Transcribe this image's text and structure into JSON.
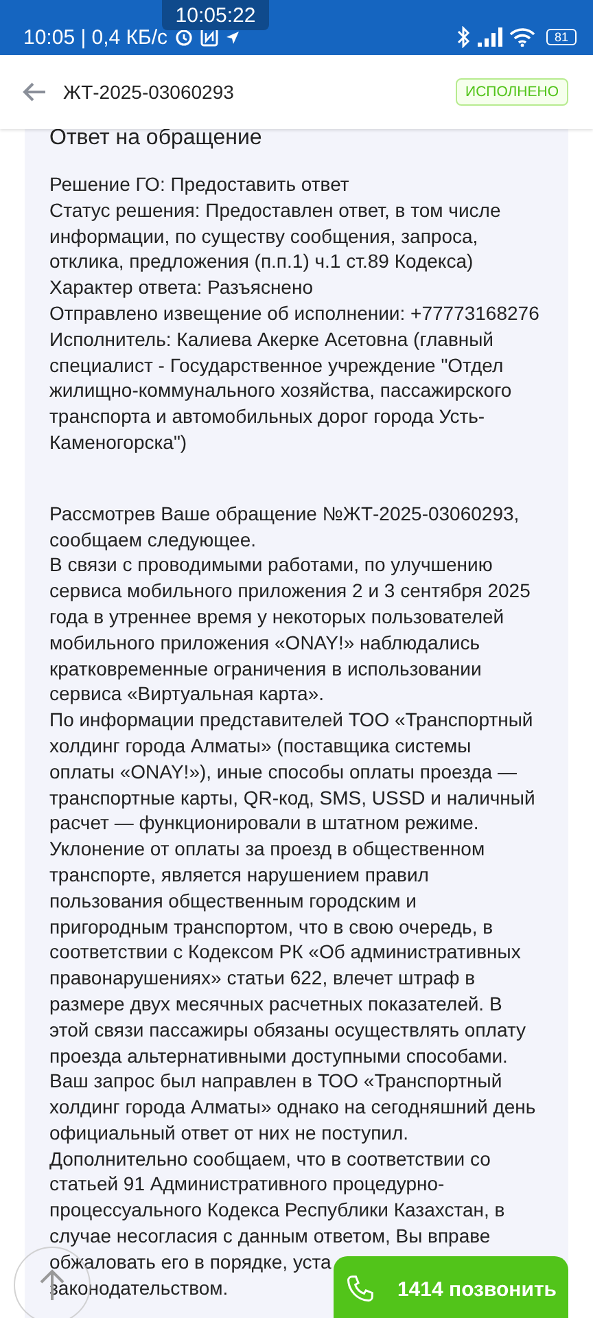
{
  "status_bar": {
    "time_speed": "10:05 | 0,4 КБ/с",
    "battery": "81"
  },
  "time_overlay": "10:05:22",
  "header": {
    "title": "ЖТ-2025-03060293",
    "status_badge": "ИСПОЛНЕНО"
  },
  "card": {
    "heading": "Ответ на обращение",
    "blocks": [
      [
        "Решение ГО: Предоставить ответ",
        "Статус решения: Предоставлен ответ, в том числе",
        "информации, по существу сообщения, запроса,",
        "отклика, предложения (п.п.1) ч.1 ст.89 Кодекса)",
        "Характер ответа: Разъяснено",
        "Отправлено извещение об исполнении: +77773168276",
        "Исполнитель: Калиева Акерке Асетовна (главный",
        "специалист - Государственное учреждение \"Отдел",
        "жилищно-коммунального хозяйства, пассажирского",
        "транспорта и автомобильных дорог города Усть-",
        "Каменогорска\")"
      ],
      [
        "Рассмотрев Ваше обращение №ЖТ-2025-03060293,",
        "сообщаем следующее.",
        "В связи с проводимыми работами, по улучшению",
        "сервиса мобильного приложения 2 и 3 сентября 2025",
        "года в утреннее время у некоторых пользователей",
        "мобильного приложения «ONAY!» наблюдались",
        "кратковременные ограничения в использовании",
        "сервиса «Виртуальная карта».",
        "По информации представителей ТОО «Транспортный",
        "холдинг города Алматы» (поставщика системы",
        "оплаты «ONAY!»), иные способы оплаты проезда —",
        "транспортные карты, QR-код, SMS, USSD и наличный",
        "расчет — функционировали в штатном режиме.",
        "Уклонение от оплаты за проезд в общественном",
        "транспорте, является нарушением правил",
        "пользования общественным городским и",
        "пригородным транспортом, что в свою очередь, в",
        "соответствии с Кодексом РК «Об административных",
        "правонарушениях» статьи 622, влечет штраф в",
        "размере двух месячных расчетных показателей. В",
        "этой связи пассажиры обязаны осуществлять оплату",
        "проезда альтернативными доступными способами.",
        "Ваш запрос был направлен в ТОО «Транспортный",
        "холдинг города Алматы» однако на сегодняшний день",
        "официальный ответ от них не поступил.",
        "Дополнительно сообщаем, что в соответствии со",
        "статьей 91 Административного процедурно-",
        "процессуального Кодекса Республики Казахстан, в",
        "случае несогласия с данным ответом, Вы вправе",
        "обжаловать его в порядке, уста",
        "законодательством."
      ]
    ]
  },
  "call_button": "1414 позвонить"
}
